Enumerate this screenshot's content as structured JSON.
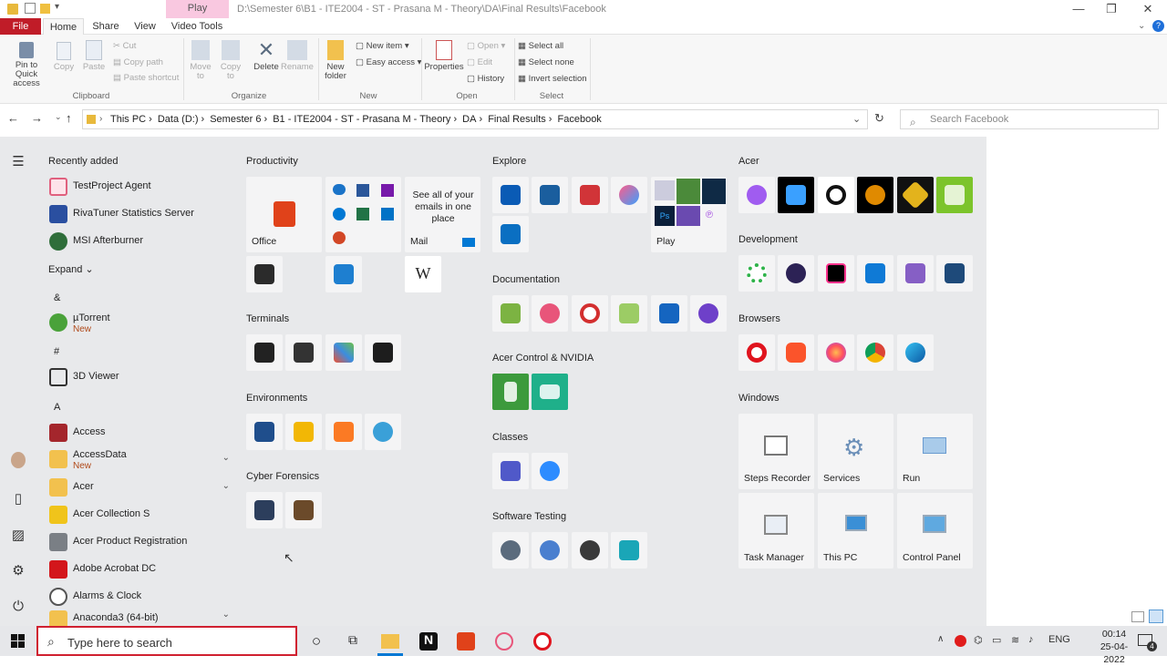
{
  "window": {
    "context_tab": "Play",
    "title_path": "D:\\Semester 6\\B1 - ITE2004 - ST - Prasana M - Theory\\DA\\Final Results\\Facebook"
  },
  "tabs": {
    "file": "File",
    "home": "Home",
    "share": "Share",
    "view": "View",
    "video_tools": "Video Tools"
  },
  "ribbon": {
    "pin": "Pin to Quick access",
    "copy": "Copy",
    "paste": "Paste",
    "cut": "Cut",
    "copy_path": "Copy path",
    "paste_shortcut": "Paste shortcut",
    "move_to": "Move to",
    "copy_to": "Copy to",
    "delete": "Delete",
    "rename": "Rename",
    "new_folder": "New folder",
    "new_item": "New item",
    "easy_access": "Easy access",
    "properties": "Properties",
    "open": "Open",
    "edit": "Edit",
    "history": "History",
    "select_all": "Select all",
    "select_none": "Select none",
    "invert_selection": "Invert selection",
    "groups": {
      "clipboard": "Clipboard",
      "organize": "Organize",
      "new": "New",
      "open": "Open",
      "select": "Select"
    }
  },
  "address": {
    "crumbs": [
      "This PC",
      "Data (D:)",
      "Semester 6",
      "B1 - ITE2004 - ST - Prasana M - Theory",
      "DA",
      "Final Results",
      "Facebook"
    ],
    "search_placeholder": "Search Facebook"
  },
  "start": {
    "recently_added": "Recently added",
    "recent": [
      "TestProject Agent",
      "RivaTuner Statistics Server",
      "MSI Afterburner"
    ],
    "expand": "Expand",
    "apps": [
      {
        "letter": "&"
      },
      {
        "name": "µTorrent",
        "new": "New"
      },
      {
        "letter": "#"
      },
      {
        "name": "3D Viewer"
      },
      {
        "letter": "A"
      },
      {
        "name": "Access"
      },
      {
        "name": "AccessData",
        "new": "New"
      },
      {
        "name": "Acer"
      },
      {
        "name": "Acer Collection S"
      },
      {
        "name": "Acer Product Registration"
      },
      {
        "name": "Adobe Acrobat DC"
      },
      {
        "name": "Alarms & Clock"
      },
      {
        "name": "Anaconda3 (64-bit)"
      }
    ],
    "groups": {
      "productivity": "Productivity",
      "explore": "Explore",
      "acer": "Acer",
      "development": "Development",
      "documentation": "Documentation",
      "terminals": "Terminals",
      "browsers": "Browsers",
      "acer_nvidia": "Acer Control & NVIDIA",
      "environments": "Environments",
      "windows": "Windows",
      "classes": "Classes",
      "cyber_forensics": "Cyber Forensics",
      "software_testing": "Software Testing"
    },
    "tiles": {
      "office": "Office",
      "mail_promo": "See all of your emails in one place",
      "mail": "Mail",
      "wikipedia": "W",
      "play": "Play",
      "steps_recorder": "Steps Recorder",
      "services": "Services",
      "run": "Run",
      "task_manager": "Task Manager",
      "this_pc": "This PC",
      "control_panel": "Control Panel",
      "ps": "Ps"
    }
  },
  "taskbar": {
    "search_placeholder": "Type here to search",
    "lang": "ENG",
    "time": "00:14",
    "date": "25-04-2022",
    "notif_count": "4"
  }
}
